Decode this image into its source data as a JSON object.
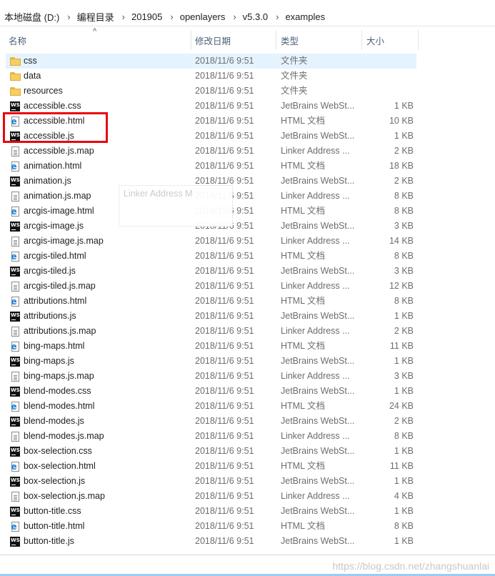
{
  "breadcrumb": [
    "本地磁盘 (D:)",
    "编程目录",
    "201905",
    "openlayers",
    "v5.3.0",
    "examples"
  ],
  "columns": {
    "name": "名称",
    "date": "修改日期",
    "type": "类型",
    "size": "大小"
  },
  "tooltip_text": "Linker Address M",
  "watermark": "https://blog.csdn.net/zhangshuanlai",
  "files": [
    {
      "name": "css",
      "date": "2018/11/6 9:51",
      "type": "文件夹",
      "size": "",
      "icon": "folder-icon"
    },
    {
      "name": "data",
      "date": "2018/11/6 9:51",
      "type": "文件夹",
      "size": "",
      "icon": "folder-icon"
    },
    {
      "name": "resources",
      "date": "2018/11/6 9:51",
      "type": "文件夹",
      "size": "",
      "icon": "folder-icon"
    },
    {
      "name": "accessible.css",
      "date": "2018/11/6 9:51",
      "type": "JetBrains WebSt...",
      "size": "1 KB",
      "icon": "webstorm-icon"
    },
    {
      "name": "accessible.html",
      "date": "2018/11/6 9:51",
      "type": "HTML 文档",
      "size": "10 KB",
      "icon": "html-icon"
    },
    {
      "name": "accessible.js",
      "date": "2018/11/6 9:51",
      "type": "JetBrains WebSt...",
      "size": "1 KB",
      "icon": "webstorm-icon"
    },
    {
      "name": "accessible.js.map",
      "date": "2018/11/6 9:51",
      "type": "Linker Address ...",
      "size": "2 KB",
      "icon": "document-icon"
    },
    {
      "name": "animation.html",
      "date": "2018/11/6 9:51",
      "type": "HTML 文档",
      "size": "18 KB",
      "icon": "html-icon"
    },
    {
      "name": "animation.js",
      "date": "2018/11/6 9:51",
      "type": "JetBrains WebSt...",
      "size": "2 KB",
      "icon": "webstorm-icon"
    },
    {
      "name": "animation.js.map",
      "date": "2018/11/6 9:51",
      "type": "Linker Address ...",
      "size": "8 KB",
      "icon": "document-icon"
    },
    {
      "name": "arcgis-image.html",
      "date": "2018/11/6 9:51",
      "type": "HTML 文档",
      "size": "8 KB",
      "icon": "html-icon"
    },
    {
      "name": "arcgis-image.js",
      "date": "2018/11/6 9:51",
      "type": "JetBrains WebSt...",
      "size": "3 KB",
      "icon": "webstorm-icon"
    },
    {
      "name": "arcgis-image.js.map",
      "date": "2018/11/6 9:51",
      "type": "Linker Address ...",
      "size": "14 KB",
      "icon": "document-icon"
    },
    {
      "name": "arcgis-tiled.html",
      "date": "2018/11/6 9:51",
      "type": "HTML 文档",
      "size": "8 KB",
      "icon": "html-icon"
    },
    {
      "name": "arcgis-tiled.js",
      "date": "2018/11/6 9:51",
      "type": "JetBrains WebSt...",
      "size": "3 KB",
      "icon": "webstorm-icon"
    },
    {
      "name": "arcgis-tiled.js.map",
      "date": "2018/11/6 9:51",
      "type": "Linker Address ...",
      "size": "12 KB",
      "icon": "document-icon"
    },
    {
      "name": "attributions.html",
      "date": "2018/11/6 9:51",
      "type": "HTML 文档",
      "size": "8 KB",
      "icon": "html-icon"
    },
    {
      "name": "attributions.js",
      "date": "2018/11/6 9:51",
      "type": "JetBrains WebSt...",
      "size": "1 KB",
      "icon": "webstorm-icon"
    },
    {
      "name": "attributions.js.map",
      "date": "2018/11/6 9:51",
      "type": "Linker Address ...",
      "size": "2 KB",
      "icon": "document-icon"
    },
    {
      "name": "bing-maps.html",
      "date": "2018/11/6 9:51",
      "type": "HTML 文档",
      "size": "11 KB",
      "icon": "html-icon"
    },
    {
      "name": "bing-maps.js",
      "date": "2018/11/6 9:51",
      "type": "JetBrains WebSt...",
      "size": "1 KB",
      "icon": "webstorm-icon"
    },
    {
      "name": "bing-maps.js.map",
      "date": "2018/11/6 9:51",
      "type": "Linker Address ...",
      "size": "3 KB",
      "icon": "document-icon"
    },
    {
      "name": "blend-modes.css",
      "date": "2018/11/6 9:51",
      "type": "JetBrains WebSt...",
      "size": "1 KB",
      "icon": "webstorm-icon"
    },
    {
      "name": "blend-modes.html",
      "date": "2018/11/6 9:51",
      "type": "HTML 文档",
      "size": "24 KB",
      "icon": "html-icon"
    },
    {
      "name": "blend-modes.js",
      "date": "2018/11/6 9:51",
      "type": "JetBrains WebSt...",
      "size": "2 KB",
      "icon": "webstorm-icon"
    },
    {
      "name": "blend-modes.js.map",
      "date": "2018/11/6 9:51",
      "type": "Linker Address ...",
      "size": "8 KB",
      "icon": "document-icon"
    },
    {
      "name": "box-selection.css",
      "date": "2018/11/6 9:51",
      "type": "JetBrains WebSt...",
      "size": "1 KB",
      "icon": "webstorm-icon"
    },
    {
      "name": "box-selection.html",
      "date": "2018/11/6 9:51",
      "type": "HTML 文档",
      "size": "11 KB",
      "icon": "html-icon"
    },
    {
      "name": "box-selection.js",
      "date": "2018/11/6 9:51",
      "type": "JetBrains WebSt...",
      "size": "1 KB",
      "icon": "webstorm-icon"
    },
    {
      "name": "box-selection.js.map",
      "date": "2018/11/6 9:51",
      "type": "Linker Address ...",
      "size": "4 KB",
      "icon": "document-icon"
    },
    {
      "name": "button-title.css",
      "date": "2018/11/6 9:51",
      "type": "JetBrains WebSt...",
      "size": "1 KB",
      "icon": "webstorm-icon"
    },
    {
      "name": "button-title.html",
      "date": "2018/11/6 9:51",
      "type": "HTML 文档",
      "size": "8 KB",
      "icon": "html-icon"
    },
    {
      "name": "button-title.js",
      "date": "2018/11/6 9:51",
      "type": "JetBrains WebSt...",
      "size": "1 KB",
      "icon": "webstorm-icon"
    }
  ],
  "highlighted_row_index": 0
}
